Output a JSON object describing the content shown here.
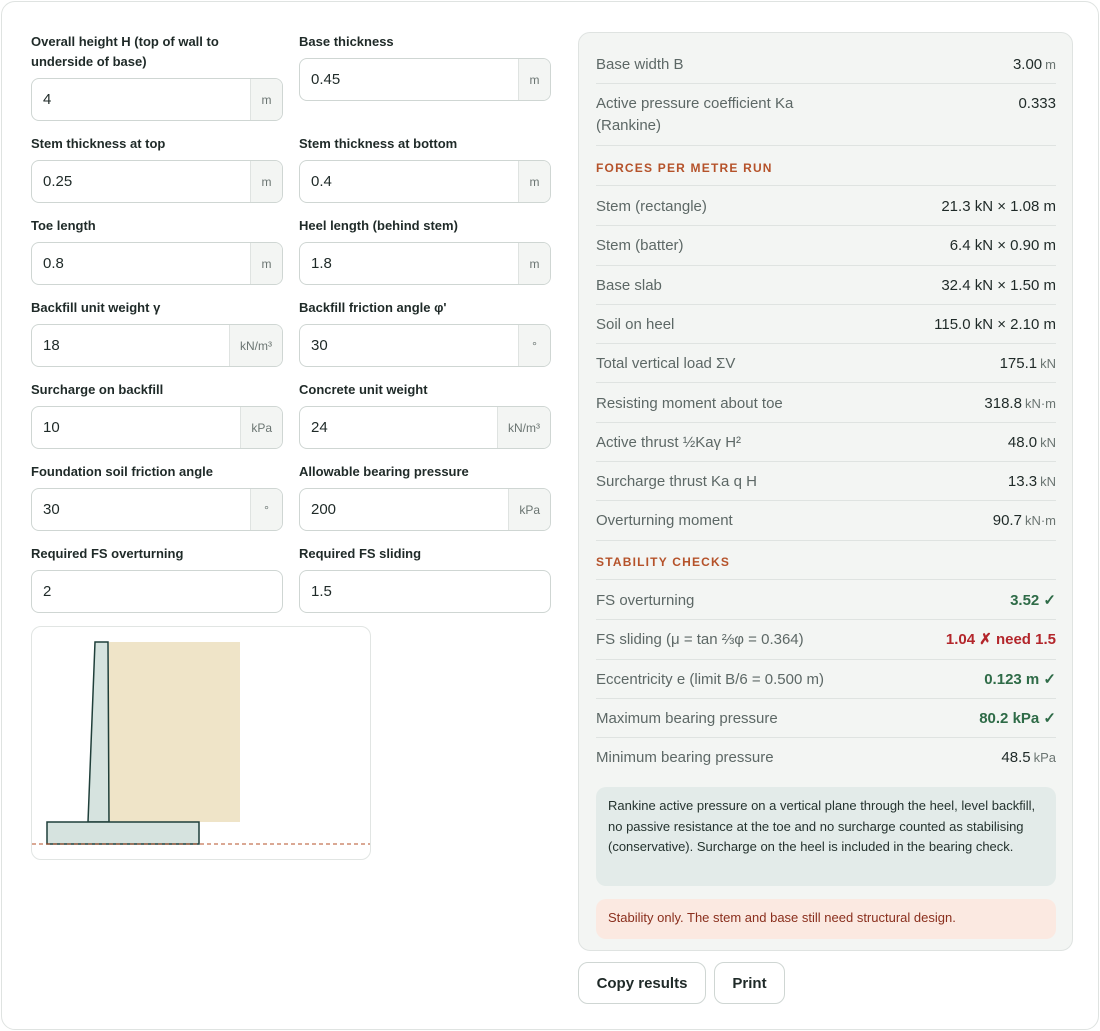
{
  "inputs": [
    {
      "label": "Overall height H (top of wall to underside of base)",
      "value": "4",
      "unit": "m"
    },
    {
      "label": "Base thickness",
      "value": "0.45",
      "unit": "m"
    },
    {
      "label": "Stem thickness at top",
      "value": "0.25",
      "unit": "m"
    },
    {
      "label": "Stem thickness at bottom",
      "value": "0.4",
      "unit": "m"
    },
    {
      "label": "Toe length",
      "value": "0.8",
      "unit": "m"
    },
    {
      "label": "Heel length (behind stem)",
      "value": "1.8",
      "unit": "m"
    },
    {
      "label": "Backfill unit weight γ",
      "value": "18",
      "unit": "kN/m³"
    },
    {
      "label": "Backfill friction angle φ'",
      "value": "30",
      "unit": "°"
    },
    {
      "label": "Surcharge on backfill",
      "value": "10",
      "unit": "kPa"
    },
    {
      "label": "Concrete unit weight",
      "value": "24",
      "unit": "kN/m³"
    },
    {
      "label": "Foundation soil friction angle",
      "value": "30",
      "unit": "°"
    },
    {
      "label": "Allowable bearing pressure",
      "value": "200",
      "unit": "kPa"
    },
    {
      "label": "Required FS overturning",
      "value": "2",
      "unit": ""
    },
    {
      "label": "Required FS sliding",
      "value": "1.5",
      "unit": ""
    }
  ],
  "results": {
    "summary": [
      {
        "label": "Base width B",
        "value": "3.00",
        "unit": "m"
      },
      {
        "label": "Active pressure coefficient Ka (Rankine)",
        "value": "0.333",
        "unit": ""
      }
    ],
    "forces_title": "FORCES PER METRE RUN",
    "forces": [
      {
        "label": "Stem (rectangle)",
        "value": "21.3 kN × 1.08 m",
        "unit": ""
      },
      {
        "label": "Stem (batter)",
        "value": "6.4 kN × 0.90 m",
        "unit": ""
      },
      {
        "label": "Base slab",
        "value": "32.4 kN × 1.50 m",
        "unit": ""
      },
      {
        "label": "Soil on heel",
        "value": "115.0 kN × 2.10 m",
        "unit": ""
      },
      {
        "label": "Total vertical load ΣV",
        "value": "175.1",
        "unit": "kN"
      },
      {
        "label": "Resisting moment about toe",
        "value": "318.8",
        "unit": "kN·m"
      },
      {
        "label": "Active thrust ½Kaγ H²",
        "value": "48.0",
        "unit": "kN"
      },
      {
        "label": "Surcharge thrust Ka q H",
        "value": "13.3",
        "unit": "kN"
      },
      {
        "label": "Overturning moment",
        "value": "90.7",
        "unit": "kN·m"
      }
    ],
    "checks_title": "STABILITY CHECKS",
    "checks": [
      {
        "label": "FS overturning",
        "value": "3.52 ✓",
        "unit": "",
        "status": "ok"
      },
      {
        "label": "FS sliding (μ = tan ⅔φ = 0.364)",
        "value": "1.04 ✗ need 1.5",
        "unit": "",
        "status": "bad"
      },
      {
        "label": "Eccentricity e (limit B/6 = 0.500 m)",
        "value": "0.123 m ✓",
        "unit": "",
        "status": "ok"
      },
      {
        "label": "Maximum bearing pressure",
        "value": "80.2 kPa ✓",
        "unit": "",
        "status": "ok"
      },
      {
        "label": "Minimum bearing pressure",
        "value": "48.5",
        "unit": "kPa",
        "status": ""
      }
    ],
    "note": "Rankine active pressure on a vertical plane through the heel, level backfill, no passive resistance at the toe and no surcharge counted as stabilising (conservative). Surcharge on the heel is included in the bearing check.",
    "warning": "Stability only. The stem and base still need structural design."
  },
  "buttons": {
    "copy": "Copy results",
    "print": "Print"
  },
  "colors": {
    "soil": "#efe4c8",
    "concrete": "#d6e3df",
    "outline": "#1f3f3a",
    "ground_line": "#b5522a",
    "ok": "#2e6b47",
    "bad": "#b3262b"
  }
}
